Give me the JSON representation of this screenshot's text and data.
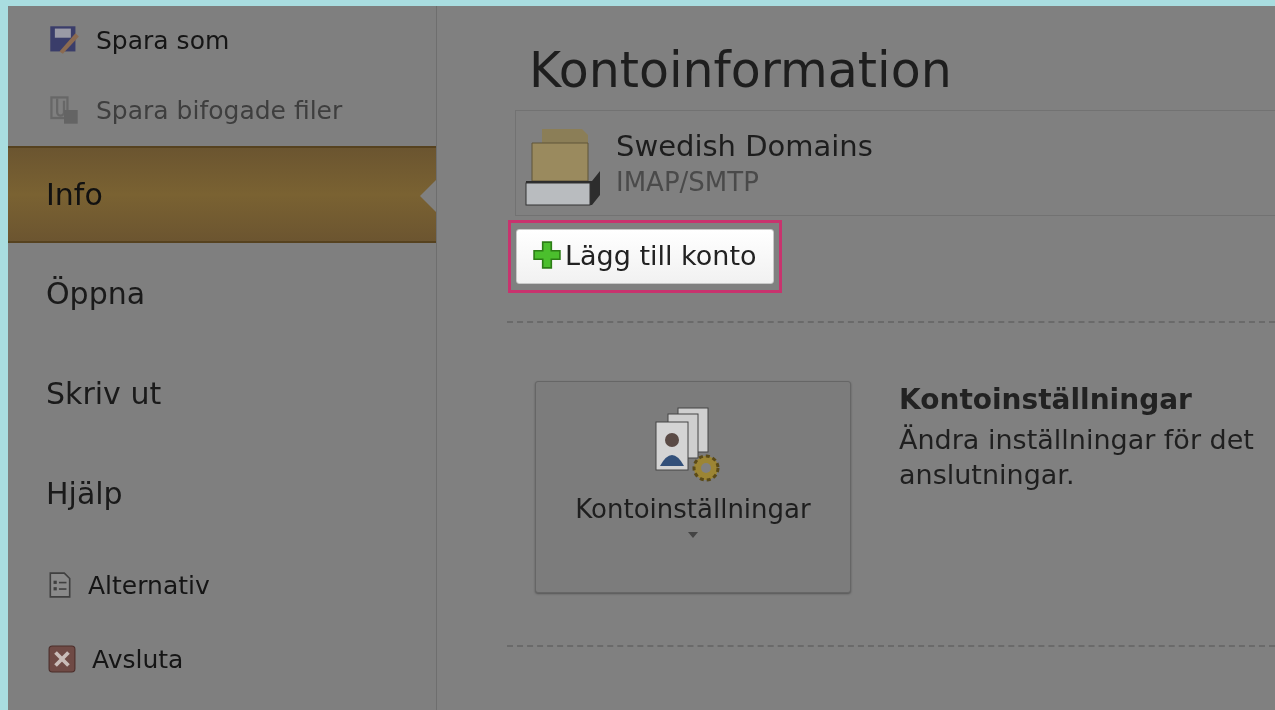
{
  "sidebar": {
    "items": [
      {
        "kind": "command",
        "label": "Spara som",
        "disabled": false
      },
      {
        "kind": "command",
        "label": "Spara bifogade filer",
        "disabled": true
      },
      {
        "kind": "tab",
        "label": "Info",
        "selected": true
      },
      {
        "kind": "tab",
        "label": "Öppna",
        "selected": false
      },
      {
        "kind": "tab",
        "label": "Skriv ut",
        "selected": false
      },
      {
        "kind": "tab",
        "label": "Hjälp",
        "selected": false
      },
      {
        "kind": "command",
        "label": "Alternativ",
        "disabled": false
      },
      {
        "kind": "command",
        "label": "Avsluta",
        "disabled": false
      }
    ]
  },
  "main": {
    "title": "Kontoinformation",
    "account": {
      "name": "Swedish Domains",
      "type": "IMAP/SMTP"
    },
    "add_account_button": {
      "label": "Lägg till konto",
      "highlighted": true
    },
    "account_settings": {
      "button_label": "Kontoinställningar",
      "heading": "Kontoinställningar",
      "description_lines": [
        "Ändra inställningar för det",
        "anslutningar."
      ]
    }
  }
}
